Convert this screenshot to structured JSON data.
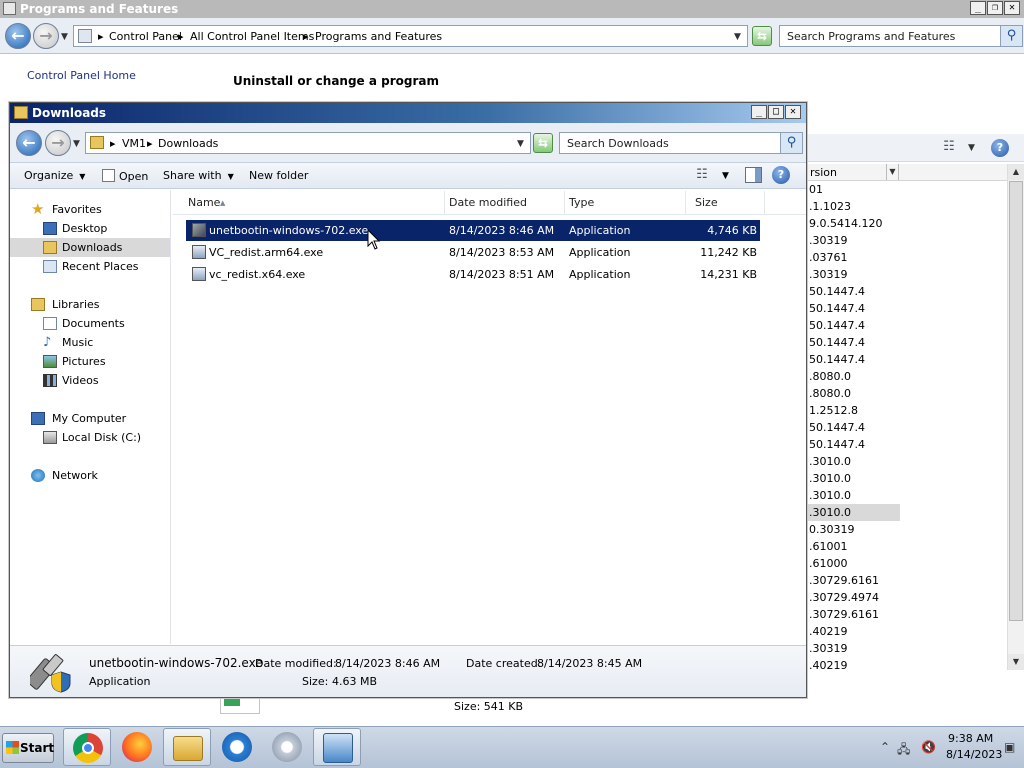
{
  "bg_window": {
    "title": "Programs and Features",
    "breadcrumb": [
      "Control Panel",
      "All Control Panel Items",
      "Programs and Features"
    ],
    "search_placeholder": "Search Programs and Features",
    "control_panel_home": "Control Panel Home",
    "heading": "Uninstall or change a program",
    "version_column_label": "rsion",
    "versions": [
      "01",
      ".1.1023",
      "9.0.5414.120",
      ".30319",
      ".03761",
      ".30319",
      "50.1447.4",
      "50.1447.4",
      "50.1447.4",
      "50.1447.4",
      "50.1447.4",
      ".8080.0",
      ".8080.0",
      "1.2512.8",
      "50.1447.4",
      "50.1447.4",
      ".3010.0",
      ".3010.0",
      ".3010.0",
      ".3010.0",
      "0.30319",
      ".61001",
      ".61000",
      ".30729.6161",
      ".30729.4974",
      ".30729.6161",
      ".40219",
      ".30319",
      ".40219"
    ],
    "selected_version_index": 19,
    "size_label": "Size:",
    "size_value": "541 KB"
  },
  "explorer": {
    "title": "Downloads",
    "breadcrumb": [
      "VM1",
      "Downloads"
    ],
    "search_placeholder": "Search Downloads",
    "commands": {
      "organize": "Organize",
      "open": "Open",
      "share_with": "Share with",
      "new_folder": "New folder"
    },
    "nav": {
      "favorites": "Favorites",
      "desktop": "Desktop",
      "downloads": "Downloads",
      "recent": "Recent Places",
      "libraries": "Libraries",
      "documents": "Documents",
      "music": "Music",
      "pictures": "Pictures",
      "videos": "Videos",
      "computer": "My Computer",
      "local_disk": "Local Disk (C:)",
      "network": "Network"
    },
    "columns": {
      "name": "Name",
      "date": "Date modified",
      "type": "Type",
      "size": "Size"
    },
    "files": [
      {
        "name": "unetbootin-windows-702.exe",
        "date": "8/14/2023 8:46 AM",
        "type": "Application",
        "size": "4,746 KB"
      },
      {
        "name": "VC_redist.arm64.exe",
        "date": "8/14/2023 8:53 AM",
        "type": "Application",
        "size": "11,242 KB"
      },
      {
        "name": "vc_redist.x64.exe",
        "date": "8/14/2023 8:51 AM",
        "type": "Application",
        "size": "14,231 KB"
      }
    ],
    "details": {
      "file_name": "unetbootin-windows-702.exe",
      "modified_label": "Date modified:",
      "modified_value": "8/14/2023 8:46 AM",
      "created_label": "Date created:",
      "created_value": "8/14/2023 8:45 AM",
      "type_value": "Application",
      "size_label": "Size:",
      "size_value": "4.63 MB"
    }
  },
  "taskbar": {
    "start": "Start",
    "time": "9:38 AM",
    "date": "8/14/2023",
    "apps": [
      "chrome-icon",
      "firefox-icon",
      "explorer-icon",
      "ie-icon",
      "media-icon",
      "control-panel-icon"
    ]
  },
  "colors": {
    "selection": "#0a246a",
    "title_gradient_start": "#0a246a",
    "title_gradient_end": "#a6caf0",
    "link": "#1e3287"
  }
}
